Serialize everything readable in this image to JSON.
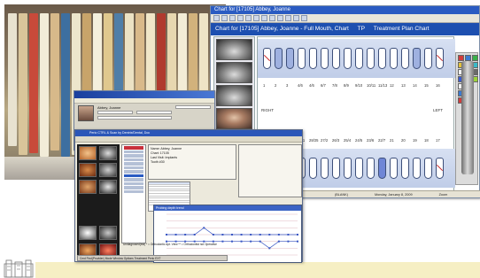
{
  "chart_window": {
    "menu_title": "Chart for [17105] Abbey, Joanne",
    "patient_header": {
      "chart_id": "Chart for [17105] Abbey, Joanne - Full Mouth, Chart",
      "mode": "TP",
      "plan": "Treatment Plan Chart"
    },
    "tooth_numbers_upper": [
      "1",
      "2",
      "3",
      "4/6",
      "4/6",
      "6/7",
      "7/8",
      "8/9",
      "9/10",
      "10/11",
      "11/13",
      "12",
      "13",
      "14",
      "15",
      "16"
    ],
    "tooth_numbers_lower": [
      "32",
      "31",
      "30",
      "29/1",
      "28/25",
      "27/2",
      "26/3",
      "25/4",
      "24/5",
      "23/6",
      "22/7",
      "21",
      "20",
      "19",
      "18",
      "17"
    ],
    "side_left": "RIGHT",
    "side_right": "LEFT",
    "status": [
      "(BLANK)",
      "Monday, January 8, 2009",
      "Zoom"
    ]
  },
  "small_window": {
    "patient_name": "Abbey, Joanne",
    "fields": [
      "Name",
      "Address",
      "Phone",
      "Balance"
    ]
  },
  "big_window": {
    "title": "Perio CTRL & Scan by Dentrix/Dental, Doc",
    "patient_block": [
      "Name: Abbey, Joanne",
      "Chart: 17105",
      "Last Visit: Implants",
      "Tooth #30"
    ],
    "graph_title": "Probing depth trend",
    "graph_legend": "Undiagnosed(est) * = Orthodontic Apt. View  ** = Orthodontist not Operative",
    "taskbar": "Cmd Find(Provider) Mode Window Options Treatment Perio EXT"
  },
  "chart_data": {
    "type": "line",
    "series": [
      {
        "values": [
          3,
          3,
          3,
          3,
          4,
          3,
          3,
          3,
          3,
          3,
          3,
          3,
          3,
          3,
          3
        ]
      },
      {
        "values": [
          2,
          2,
          2,
          2,
          2,
          2,
          2,
          2,
          2,
          2,
          2,
          1,
          2,
          2,
          2
        ]
      }
    ],
    "ylim": [
      0,
      6
    ],
    "grid": true
  },
  "colors": {
    "title_bar": "#2a5bc2",
    "patient_bar": "#1d4fb0",
    "tooth_band": "#c0cde8",
    "footer": "#f6efc4"
  }
}
